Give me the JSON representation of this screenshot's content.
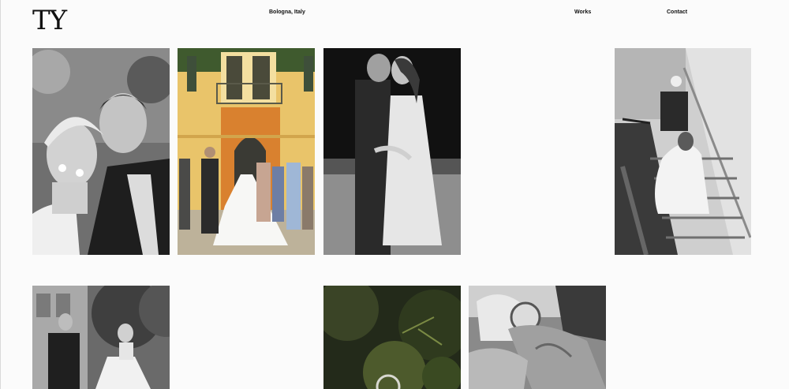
{
  "header": {
    "logo": "TY",
    "location": "Bologna, Italy",
    "nav": {
      "works": "Works",
      "contact": "Contact"
    }
  },
  "gallery": {
    "photos": [
      {
        "subject": "couple-portrait-bw"
      },
      {
        "subject": "bride-walking-to-villa"
      },
      {
        "subject": "couple-embrace-bw"
      },
      {
        "subject": "bride-on-staircase-bw"
      },
      {
        "subject": "couple-in-garden-bw"
      },
      {
        "subject": "ring-in-moss"
      },
      {
        "subject": "hands-with-ring-bw"
      }
    ]
  },
  "colors": {
    "background": "#fbfbfb",
    "text": "#111111",
    "villa_wall": "#e9c46a",
    "door_orange": "#d9812f"
  }
}
